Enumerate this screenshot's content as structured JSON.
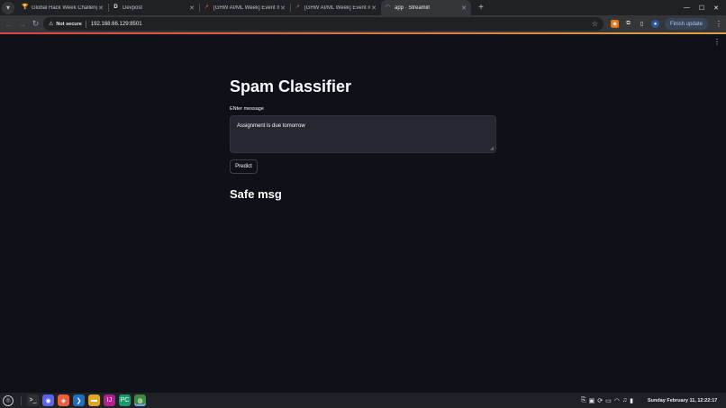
{
  "browser": {
    "tabs": [
      {
        "title": "Global Hack Week Challenge",
        "icon": "trophy-icon",
        "active": false
      },
      {
        "title": "Devpost",
        "icon": "devpost-icon",
        "active": false
      },
      {
        "title": "[GHW AI/ML Week] Event m",
        "icon": "rocket-icon",
        "active": false
      },
      {
        "title": "[GHW AI/ML Week] Event m",
        "icon": "rocket-icon",
        "active": false
      },
      {
        "title": "app · Streamlit",
        "icon": "streamlit-icon",
        "active": true
      }
    ],
    "address": {
      "security_label": "Not secure",
      "url": "192.168.66.129:8501"
    },
    "finish_update_label": "Finish update"
  },
  "app": {
    "title": "Spam Classifier",
    "input_label": "ENter message",
    "input_value": "Assignment is due tomorrow",
    "button_label": "Predict",
    "result": "Safe msg"
  },
  "taskbar": {
    "clock": "Sunday February 11, 12:22:17",
    "apps": [
      "terminal-icon",
      "discord-icon",
      "vpn-icon",
      "vscode-icon",
      "files-icon",
      "intellij-icon",
      "pycharm-icon",
      "chrome-icon"
    ]
  },
  "colors": {
    "app_bg": "#0e1117",
    "text": "#fafafa",
    "input_bg": "#262730",
    "accent_bar": "#ff4b4b",
    "update_button_bg": "#394457"
  }
}
